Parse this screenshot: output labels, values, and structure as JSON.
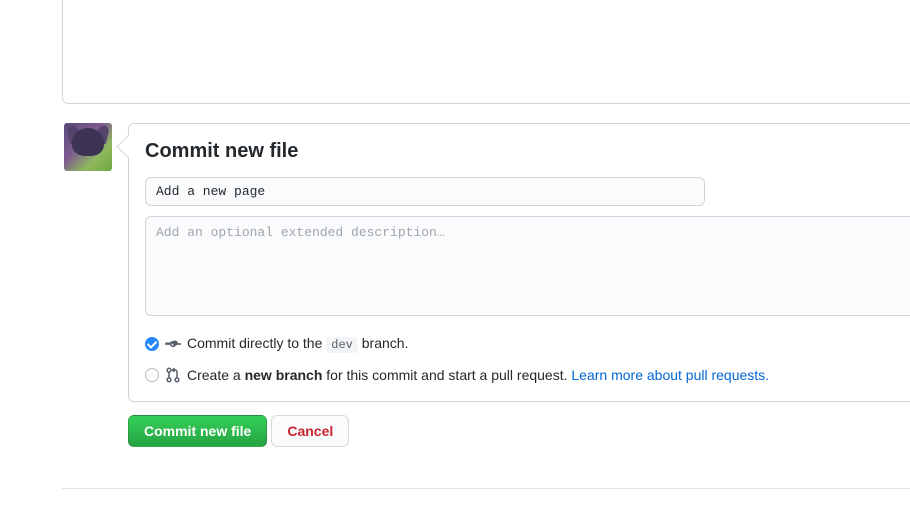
{
  "commit": {
    "heading": "Commit new file",
    "summary_value": "Add a new page",
    "description_placeholder": "Add an optional extended description…"
  },
  "branch": {
    "direct_prefix": "Commit directly to the ",
    "direct_branch": "dev",
    "direct_suffix": " branch.",
    "create_prefix": "Create a ",
    "create_bold": "new branch",
    "create_suffix": " for this commit and start a pull request. ",
    "learn_more": "Learn more about pull requests."
  },
  "buttons": {
    "commit": "Commit new file",
    "cancel": "Cancel"
  }
}
